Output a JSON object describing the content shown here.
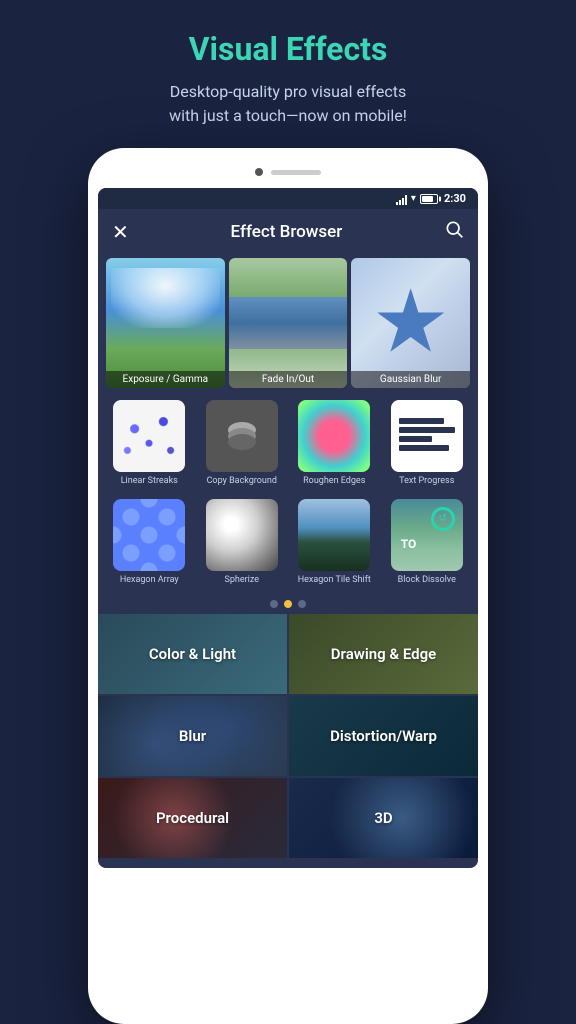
{
  "page": {
    "background_color": "#1a2340"
  },
  "header": {
    "title": "Visual Effects",
    "subtitle_line1": "Desktop-quality pro visual effects",
    "subtitle_line2": "with just a touch—now on mobile!"
  },
  "status_bar": {
    "time": "2:30"
  },
  "toolbar": {
    "title": "Effect Browser",
    "close_icon": "✕",
    "search_icon": "🔍"
  },
  "top_effects": [
    {
      "label": "Exposure / Gamma",
      "thumb": "exposure"
    },
    {
      "label": "Fade In/Out",
      "thumb": "fadeinout"
    },
    {
      "label": "Gaussian Blur",
      "thumb": "gaussianblur"
    }
  ],
  "middle_effects_row1": [
    {
      "name": "Linear Streaks",
      "thumb": "linear-streaks"
    },
    {
      "name": "Copy Background",
      "thumb": "copy-bg"
    },
    {
      "name": "Roughen Edges",
      "thumb": "roughen"
    },
    {
      "name": "Text Progress",
      "thumb": "text-progress"
    }
  ],
  "middle_effects_row2": [
    {
      "name": "Hexagon Array",
      "thumb": "hexagon"
    },
    {
      "name": "Spherize",
      "thumb": "spherize"
    },
    {
      "name": "Hexagon Tile Shift",
      "thumb": "hex-tile"
    },
    {
      "name": "Block Dissolve",
      "thumb": "block-dissolve"
    }
  ],
  "dots": [
    {
      "active": false
    },
    {
      "active": true
    },
    {
      "active": false
    }
  ],
  "categories": [
    {
      "name": "Color & Light",
      "style": "color-light"
    },
    {
      "name": "Drawing & Edge",
      "style": "drawing"
    },
    {
      "name": "Blur",
      "style": "blur"
    },
    {
      "name": "Distortion/Warp",
      "style": "distortion"
    },
    {
      "name": "Procedural",
      "style": "procedural"
    },
    {
      "name": "3D",
      "style": "3d"
    }
  ]
}
